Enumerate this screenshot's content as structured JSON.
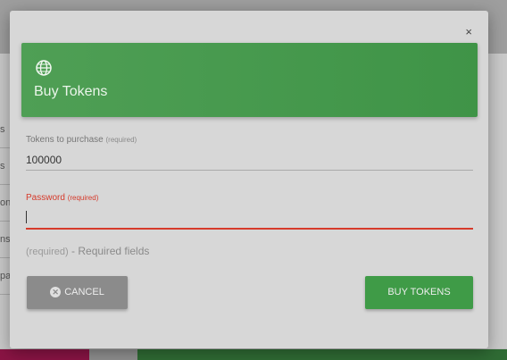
{
  "background": {
    "sidebar_fragments": [
      "s",
      "s",
      "on",
      "ns",
      "pa"
    ]
  },
  "dialog": {
    "close_label": "×",
    "header": {
      "icon": "globe-icon",
      "title": "Buy Tokens",
      "color": "#43a047"
    },
    "fields": {
      "tokens": {
        "label": "Tokens to purchase",
        "required_tag": "(required)",
        "value": "100000"
      },
      "password": {
        "label": "Password",
        "required_tag": "(required)",
        "value": "",
        "error_color": "#d63a2b"
      }
    },
    "required_note": {
      "tag": "(required)",
      "text": " - Required fields"
    },
    "buttons": {
      "cancel_label": "CANCEL",
      "cancel_icon": "x-circle-icon",
      "buy_label": "BUY TOKENS"
    }
  }
}
